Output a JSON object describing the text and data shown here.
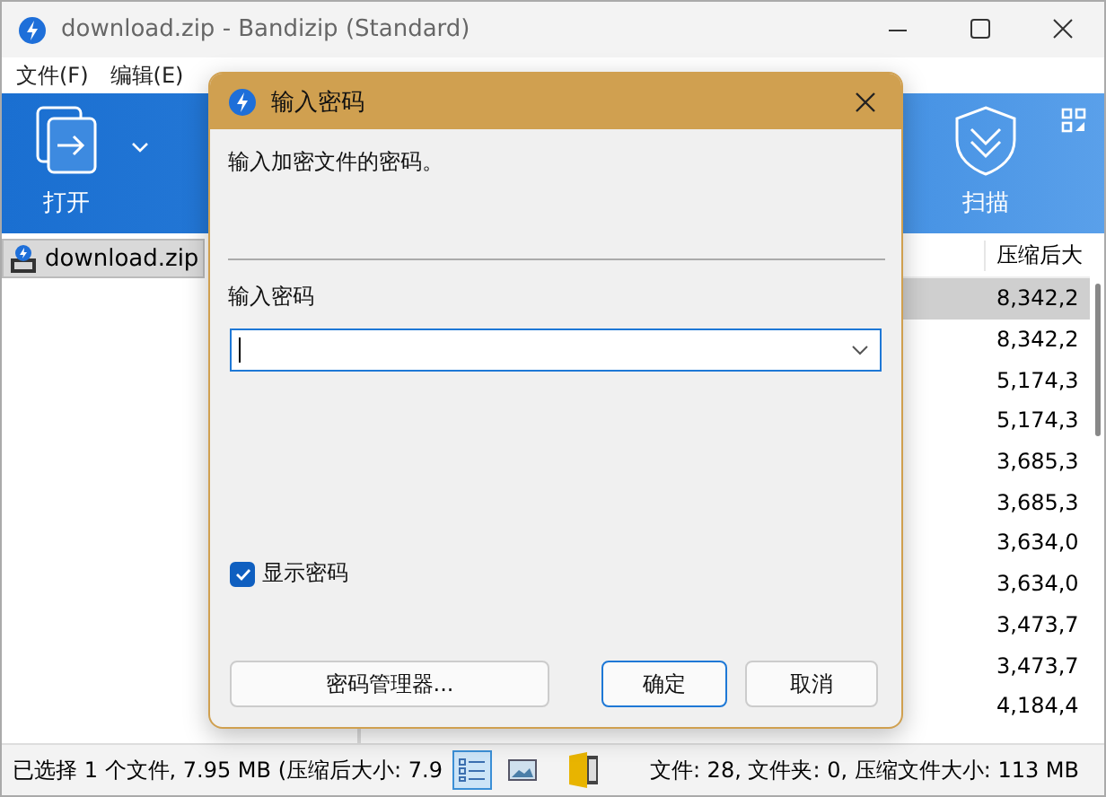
{
  "window": {
    "title": "download.zip - Bandizip (Standard)"
  },
  "menu": [
    "文件(F)",
    "编辑(E)"
  ],
  "toolbar": [
    {
      "label": "打开",
      "kind": "open"
    },
    {
      "label": "扫描",
      "kind": "scan"
    }
  ],
  "tree": [
    {
      "label": "download.zip",
      "selected": true
    }
  ],
  "list": {
    "column": "压缩后大",
    "rows": [
      {
        "value": "8,342,2",
        "selected": true
      },
      {
        "value": "8,342,2",
        "selected": false
      },
      {
        "value": "5,174,3",
        "selected": false
      },
      {
        "value": "5,174,3",
        "selected": false
      },
      {
        "value": "3,685,3",
        "selected": false
      },
      {
        "value": "3,685,3",
        "selected": false
      },
      {
        "value": "3,634,0",
        "selected": false
      },
      {
        "value": "3,634,0",
        "selected": false
      },
      {
        "value": "3,473,7",
        "selected": false
      },
      {
        "value": "3,473,7",
        "selected": false
      },
      {
        "value": "4,184,4",
        "selected": false
      }
    ]
  },
  "status_bar": {
    "selection": "已选择 1 个文件, 7.95 MB (压缩后大小: 7.9",
    "views": [
      {
        "kind": "details",
        "selected": true
      },
      {
        "kind": "thumbnails",
        "selected": false
      }
    ],
    "summary": "文件: 28, 文件夹: 0, 压缩文件大小: 113 MB"
  },
  "dialog": {
    "title": "输入密码",
    "message": "输入加密文件的密码。",
    "field_label": "输入密码",
    "show_password": {
      "label": "显示密码",
      "checked": true
    },
    "buttons": [
      {
        "label": "密码管理器...",
        "default": false
      },
      {
        "label": "确定",
        "default": true
      },
      {
        "label": "取消",
        "default": false
      }
    ]
  }
}
